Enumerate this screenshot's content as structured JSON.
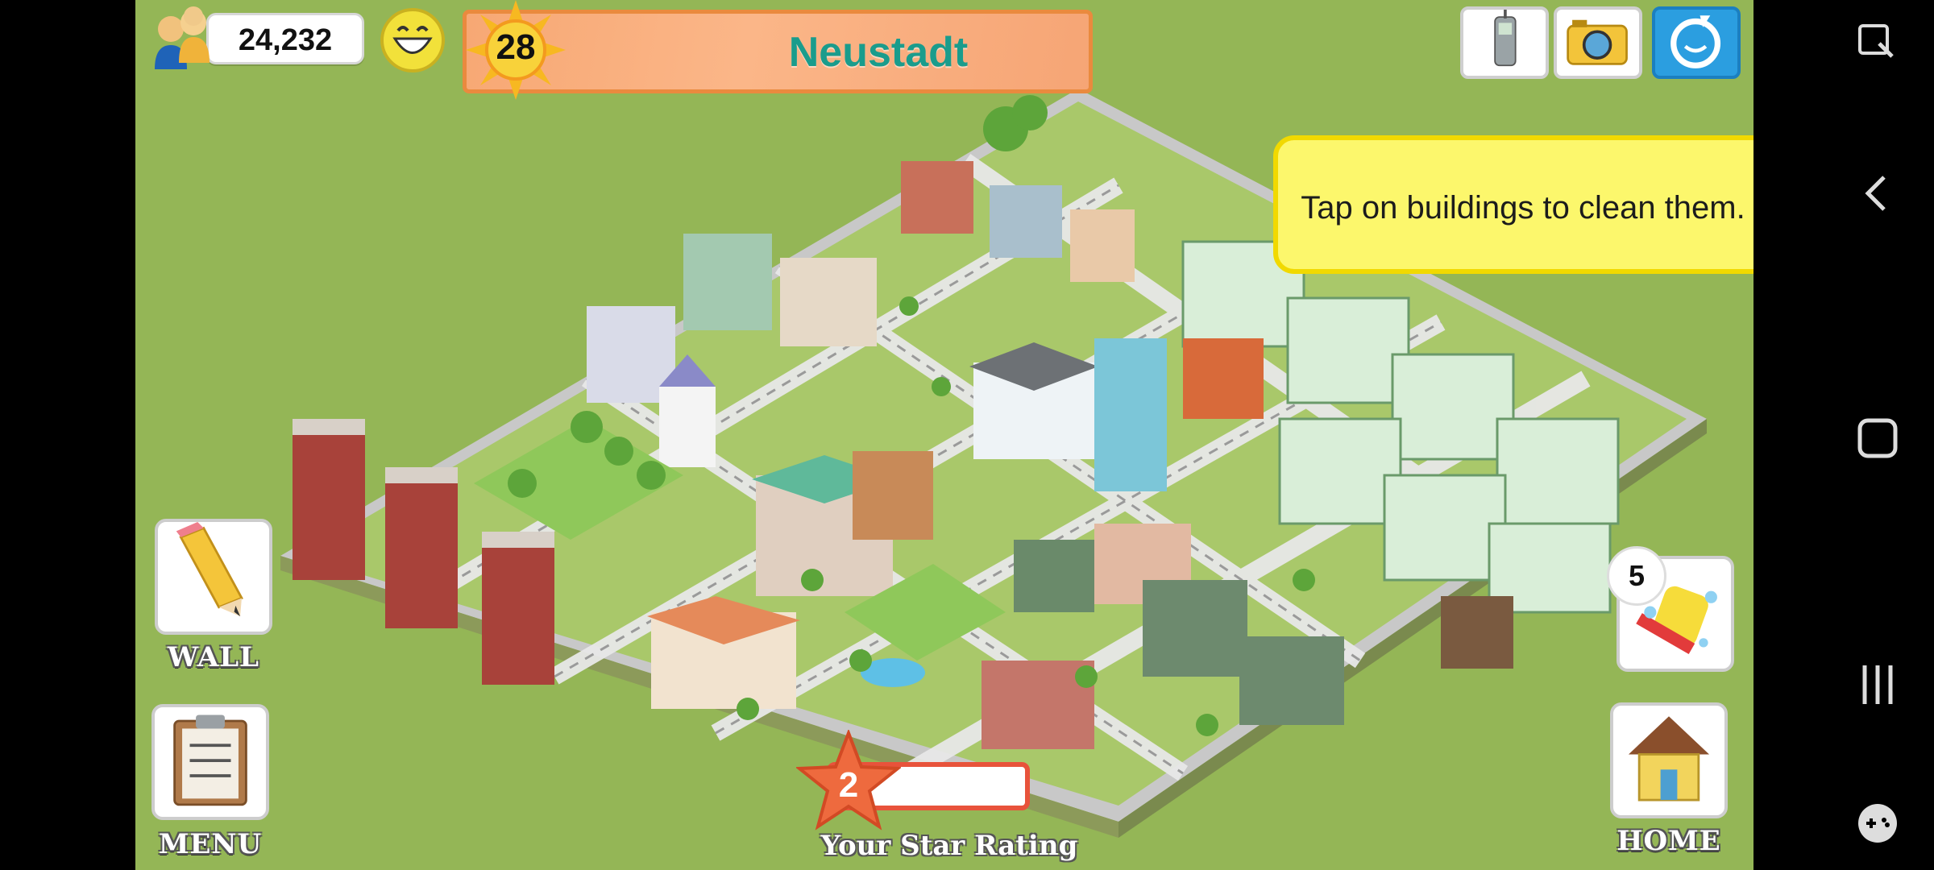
{
  "hud": {
    "population": "24,232",
    "level": "28",
    "city_name": "Neustadt",
    "clean_count": "5",
    "star_rating": "2",
    "star_rating_label": "Your Star Rating"
  },
  "tooltip": {
    "text": "Tap on buildings to clean them."
  },
  "buttons": {
    "wall_label": "WALL",
    "menu_label": "MENU",
    "home_label": "HOME"
  },
  "icons": {
    "population": "population-icon",
    "happiness": "smiley-icon",
    "level": "sun-icon",
    "phone": "phone-icon",
    "camera": "camera-icon",
    "social": "social-icon",
    "wall": "pencil-icon",
    "menu": "clipboard-icon",
    "home": "house-icon",
    "clean": "sponge-icon",
    "star": "star-icon"
  },
  "colors": {
    "ground": "#94b656",
    "banner": "#fbb688",
    "city_name": "#1a9c8c",
    "tooltip": "#fcf76c",
    "star": "#e8533b"
  }
}
